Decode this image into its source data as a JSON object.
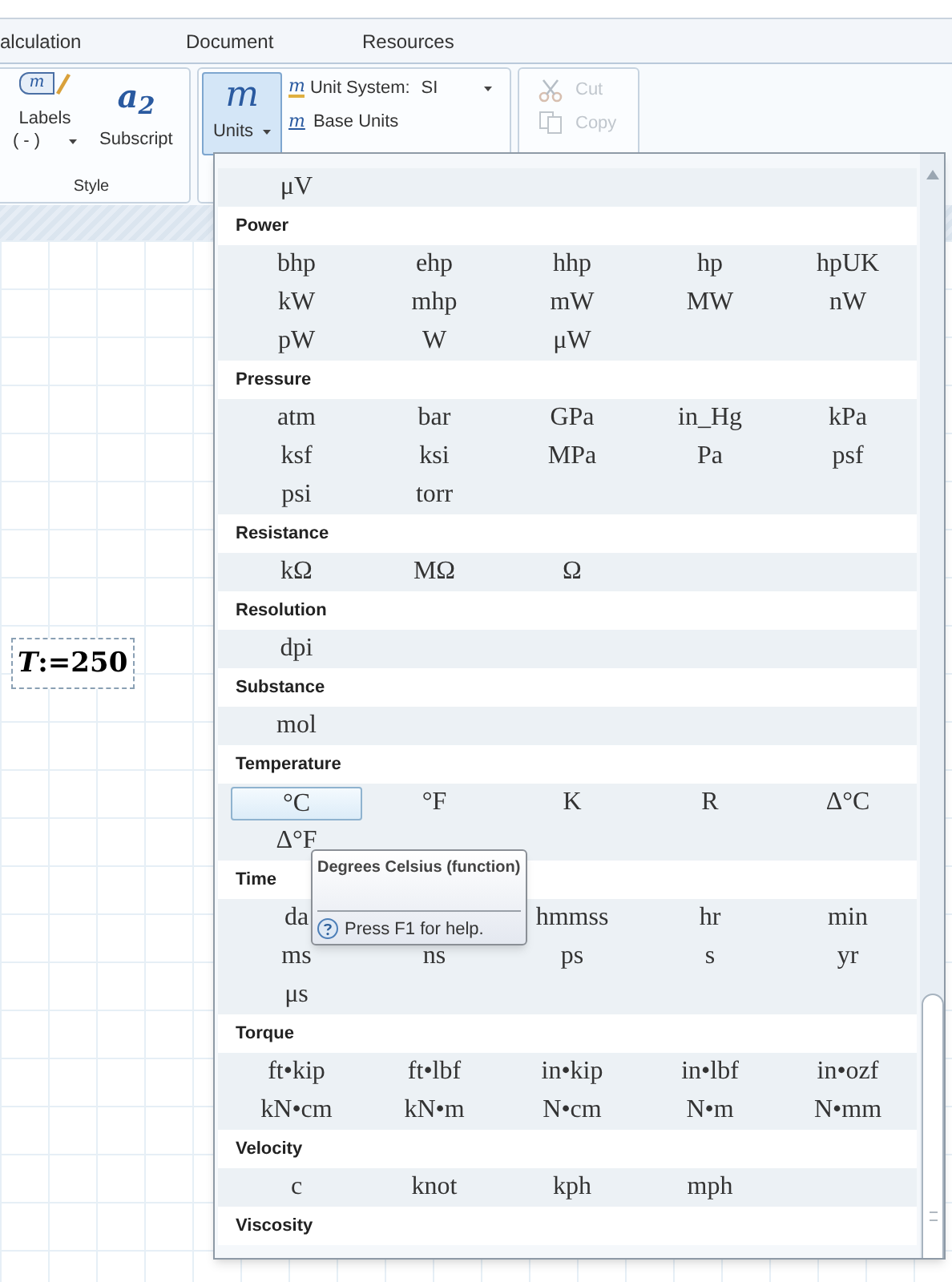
{
  "ribbon_tabs": [
    {
      "label": "alculation",
      "selected": false
    },
    {
      "label": "Document",
      "selected": false
    },
    {
      "label": "Resources",
      "selected": false
    }
  ],
  "style_group": {
    "labels_button": {
      "icon_text": "m",
      "label": "Labels",
      "value": "( - )"
    },
    "subscript_button": {
      "icon_text": "a$_{2}$",
      "label": "Subscript"
    },
    "title": "Style"
  },
  "units_group": {
    "units_button": {
      "icon_text": "m",
      "label": "Units",
      "open": true
    },
    "unit_system": {
      "icon_text": "m",
      "label": "Unit System:",
      "value": "SI"
    },
    "base_units": {
      "icon_text": "m",
      "label": "Base Units"
    }
  },
  "clipboard_group": {
    "buttons": [
      {
        "label": "Cut",
        "disabled": true
      },
      {
        "label": "Copy",
        "disabled": true
      }
    ]
  },
  "worksheet": {
    "expression": "*T*:=250"
  },
  "units_menu": {
    "sections": [
      {
        "units": [
          {
            "kind": "unit",
            "label": "μV",
            "selected": false
          }
        ]
      },
      {
        "heading": "Power",
        "units": [
          {
            "kind": "unit",
            "label": "bhp",
            "selected": false
          },
          {
            "kind": "unit",
            "label": "ehp",
            "selected": false
          },
          {
            "kind": "unit",
            "label": "hhp",
            "selected": false
          },
          {
            "kind": "unit",
            "label": "hp",
            "selected": false
          },
          {
            "kind": "unit",
            "label": "hpUK",
            "selected": false
          },
          {
            "kind": "unit",
            "label": "kW",
            "selected": false
          },
          {
            "kind": "unit",
            "label": "mhp",
            "selected": false
          },
          {
            "kind": "unit",
            "label": "mW",
            "selected": false
          },
          {
            "kind": "unit",
            "label": "MW",
            "selected": false
          },
          {
            "kind": "unit",
            "label": "nW",
            "selected": false
          },
          {
            "kind": "unit",
            "label": "pW",
            "selected": false
          },
          {
            "kind": "unit",
            "label": "W",
            "selected": false
          },
          {
            "kind": "unit",
            "label": "μW",
            "selected": false
          }
        ]
      },
      {
        "heading": "Pressure",
        "units": [
          {
            "kind": "unit",
            "label": "atm",
            "selected": false
          },
          {
            "kind": "unit",
            "label": "bar",
            "selected": false
          },
          {
            "kind": "unit",
            "label": "GPa",
            "selected": false
          },
          {
            "kind": "unit",
            "label": "in_Hg",
            "selected": false
          },
          {
            "kind": "unit",
            "label": "kPa",
            "selected": false
          },
          {
            "kind": "unit",
            "label": "ksf",
            "selected": false
          },
          {
            "kind": "unit",
            "label": "ksi",
            "selected": false
          },
          {
            "kind": "unit",
            "label": "MPa",
            "selected": false
          },
          {
            "kind": "unit",
            "label": "Pa",
            "selected": false
          },
          {
            "kind": "unit",
            "label": "psf",
            "selected": false
          },
          {
            "kind": "unit",
            "label": "psi",
            "selected": false
          },
          {
            "kind": "unit",
            "label": "torr",
            "selected": false
          }
        ]
      },
      {
        "heading": "Resistance",
        "units": [
          {
            "kind": "unit",
            "label": "kΩ",
            "selected": false
          },
          {
            "kind": "unit",
            "label": "MΩ",
            "selected": false
          },
          {
            "kind": "unit",
            "label": "Ω",
            "selected": false
          }
        ]
      },
      {
        "heading": "Resolution",
        "units": [
          {
            "kind": "unit",
            "label": "dpi",
            "selected": false
          }
        ]
      },
      {
        "heading": "Substance",
        "units": [
          {
            "kind": "unit",
            "label": "mol",
            "selected": false
          }
        ]
      },
      {
        "heading": "Temperature",
        "units": [
          {
            "kind": "unit",
            "label": "°C",
            "selected": true
          },
          {
            "kind": "unit",
            "label": "°F",
            "selected": false
          },
          {
            "kind": "unit",
            "label": "K",
            "selected": false
          },
          {
            "kind": "unit",
            "label": "R",
            "selected": false
          },
          {
            "kind": "unit",
            "label": "Δ°C",
            "selected": false
          },
          {
            "kind": "unit",
            "label": "Δ°F",
            "selected": false
          }
        ]
      },
      {
        "heading": "Time",
        "units": [
          {
            "kind": "unit",
            "label": "da",
            "selected": false
          },
          {
            "kind": "covered"
          },
          {
            "kind": "unit",
            "label": "hmmss",
            "selected": false
          },
          {
            "kind": "unit",
            "label": "hr",
            "selected": false
          },
          {
            "kind": "unit",
            "label": "min",
            "selected": false
          },
          {
            "kind": "unit",
            "label": "ms",
            "selected": false
          },
          {
            "kind": "unit",
            "label": "ns",
            "selected": false
          },
          {
            "kind": "unit",
            "label": "ps",
            "selected": false
          },
          {
            "kind": "unit",
            "label": "s",
            "selected": false
          },
          {
            "kind": "unit",
            "label": "yr",
            "selected": false
          },
          {
            "kind": "unit",
            "label": "μs",
            "selected": false
          }
        ]
      },
      {
        "heading": "Torque",
        "units": [
          {
            "kind": "unit",
            "label": "ft•kip",
            "selected": false
          },
          {
            "kind": "unit",
            "label": "ft•lbf",
            "selected": false
          },
          {
            "kind": "unit",
            "label": "in•kip",
            "selected": false
          },
          {
            "kind": "unit",
            "label": "in•lbf",
            "selected": false
          },
          {
            "kind": "unit",
            "label": "in•ozf",
            "selected": false
          },
          {
            "kind": "unit",
            "label": "kN•cm",
            "selected": false
          },
          {
            "kind": "unit",
            "label": "kN•m",
            "selected": false
          },
          {
            "kind": "unit",
            "label": "N•cm",
            "selected": false
          },
          {
            "kind": "unit",
            "label": "N•m",
            "selected": false
          },
          {
            "kind": "unit",
            "label": "N•mm",
            "selected": false
          }
        ]
      },
      {
        "heading": "Velocity",
        "units": [
          {
            "kind": "unit",
            "label": "c",
            "selected": false
          },
          {
            "kind": "unit",
            "label": "knot",
            "selected": false
          },
          {
            "kind": "unit",
            "label": "kph",
            "selected": false
          },
          {
            "kind": "unit",
            "label": "mph",
            "selected": false
          }
        ]
      },
      {
        "heading": "Viscosity"
      }
    ]
  },
  "tooltip": {
    "title": "Degrees Celsius (function)",
    "help": "Press F1 for help."
  }
}
